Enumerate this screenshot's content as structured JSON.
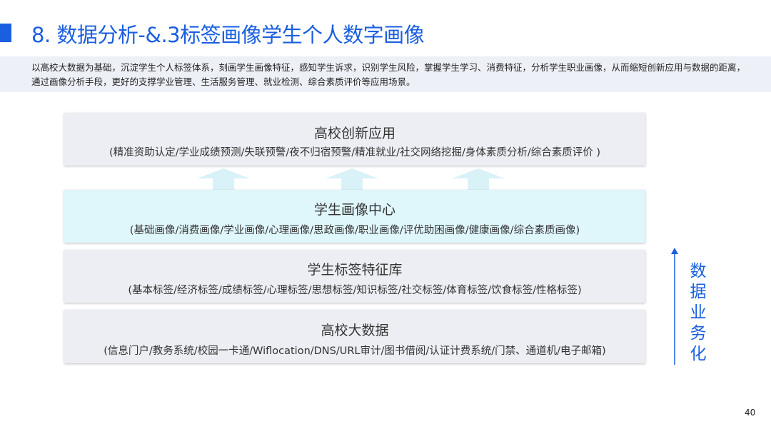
{
  "header": {
    "title": "8. 数据分析-&.3标签画像学生个人数字画像"
  },
  "intro": {
    "text": "以高校大数据为基础，沉淀学生个人标签体系，刻画学生画像特征，感知学生诉求，识别学生风险，掌握学生学习、消费特征，分析学生职业画像，从而缩短创新应用与数据的距离，通过画像分析手段，更好的支撑学业管理、生活服务管理、就业检测、综合素质评价等应用场景。"
  },
  "layers": [
    {
      "name": "高校创新应用",
      "desc": "(精准资助认定/学业成绩预测/失联预警/夜不归宿预警/精准就业/社交网络挖掘/身体素质分析/综合素质评价 )"
    },
    {
      "name": "学生画像中心",
      "desc": "(基础画像/消费画像/学业画像/心理画像/思政画像/职业画像/评优助困画像/健康画像/综合素质画像)"
    },
    {
      "name": "学生标签特征库",
      "desc": "(基本标签/经济标签/成绩标签/心理标签/思想标签/知识标签/社交标签/体育标签/饮食标签/性格标签)"
    },
    {
      "name": "高校大数据",
      "desc": "(信息门户/教务系统/校园一卡通/Wiflocation/DNS/URL审计/图书借阅/认证计费系统/门禁、通道机/电子邮箱)"
    }
  ],
  "side": {
    "label": "数据业务化"
  },
  "footer": {
    "page_number": "40"
  },
  "colors": {
    "accent": "#1a5fe0",
    "layer_bg": "#eceef3",
    "highlight_bg": "#dff6fb",
    "arrow": "#d9f2f8",
    "intro_bg": "#eef0f8"
  }
}
